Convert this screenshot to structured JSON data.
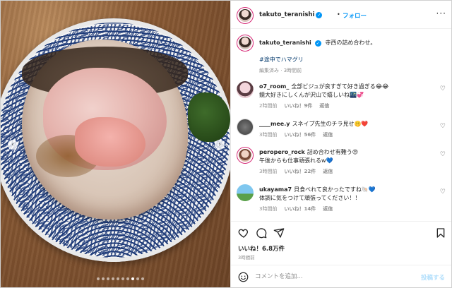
{
  "header": {
    "username": "takuto_teranishi",
    "separator": "•",
    "follow_label": "フォロー",
    "more_label": "···"
  },
  "caption": {
    "username": "takuto_teranishi",
    "text": "寺西の詰め合わせ。",
    "hashtag": "#途中でハマグリ",
    "meta": "編集済み · 3時間前"
  },
  "comments": [
    {
      "username": "o7_room_",
      "text": "全部ビジュが良すぎて好き過ぎる😂😂",
      "text2": "鏡大好きにしくんが沢山で嬉しいね🌃💞",
      "time": "2時間前",
      "likes": "いいね！9件",
      "reply": "返信"
    },
    {
      "username": "____mee.y",
      "text": "スネイプ先生のチラ見せ🤫❤️",
      "text2": "",
      "time": "3時間前",
      "likes": "いいね！56件",
      "reply": "返信"
    },
    {
      "username": "peropero_rock",
      "text": "詰め合わせ有難う😍",
      "text2": "午後からも仕事頑張れるw💙",
      "time": "3時間前",
      "likes": "いいね！22件",
      "reply": "返信"
    },
    {
      "username": "ukayama7",
      "text": "貝食べれて良かったですね🐚💙",
      "text2": "体調に気をつけて頑張ってください！！",
      "time": "3時間前",
      "likes": "いいね！14件",
      "reply": "返信"
    }
  ],
  "likes_text": "いいね！6.8万件",
  "time_text": "3時間前",
  "add_comment": {
    "placeholder": "コメントを追加...",
    "post_label": "投稿する"
  },
  "photo": {
    "prev_label": "‹",
    "next_label": "›",
    "dot_count": 10,
    "active_dot": 7
  },
  "colors": {
    "link": "#0095f6",
    "verified": "#0095f6",
    "hashtag": "#00376b",
    "muted": "#8e8e8e"
  },
  "icons": [
    "heart-icon",
    "comment-icon",
    "share-icon",
    "bookmark-icon",
    "emoji-icon",
    "verified-icon",
    "more-icon"
  ]
}
